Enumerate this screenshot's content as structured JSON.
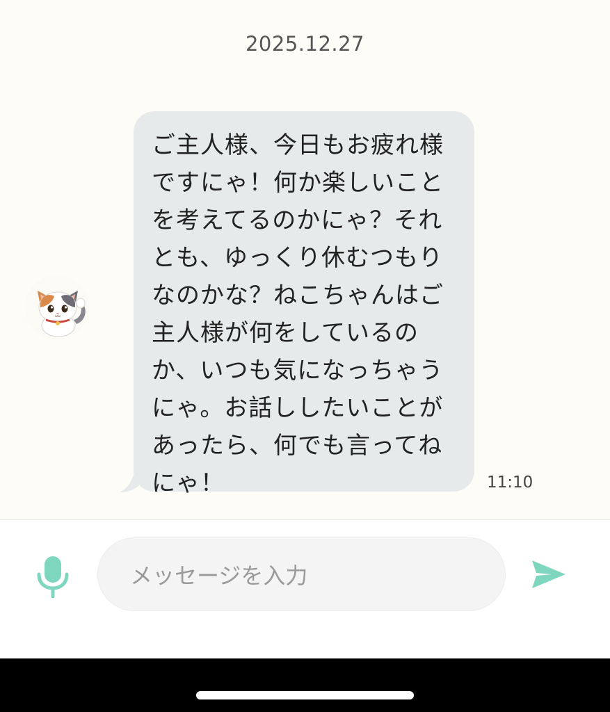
{
  "chat": {
    "date": "2025.12.27",
    "message": {
      "sender_avatar": "calico-cat-avatar",
      "text": "ご主人様、今日もお疲れ様\nですにゃ！何か楽しいこと\nを考えてるのかにゃ？それ\nとも、ゆっくり休むつもり\nなのかな？ねこちゃんはご\n主人様が何をしているの\nか、いつも気になっちゃう\nにゃ。お話ししたいことが\nあったら、何でも言ってね\nにゃ！",
      "time": "11:10"
    }
  },
  "composer": {
    "placeholder": "メッセージを入力",
    "mic_icon": "microphone-icon",
    "send_icon": "send-icon"
  },
  "colors": {
    "background": "#fdfcf7",
    "bubble": "#e7eaea",
    "accent": "#7fd6bf",
    "input_bg": "#f4f4f4"
  }
}
